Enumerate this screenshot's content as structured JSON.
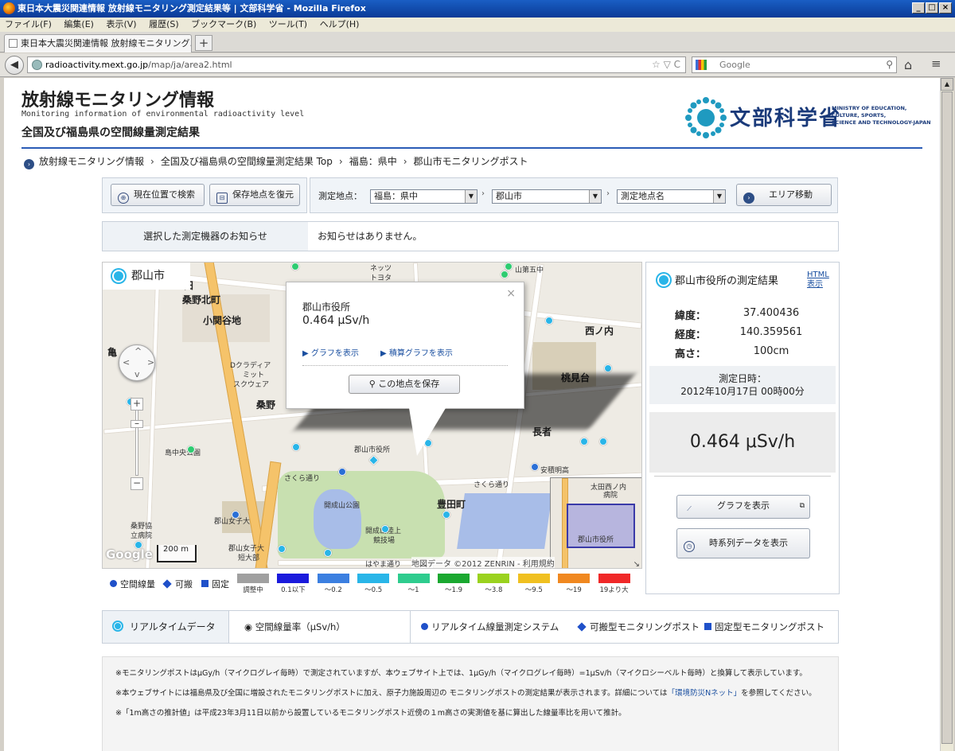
{
  "browser": {
    "title": "東日本大震災関連情報 放射線モニタリング測定結果等 | 文部科学省 - Mozilla Firefox",
    "menu": [
      "ファイル(F)",
      "編集(E)",
      "表示(V)",
      "履歴(S)",
      "ブックマーク(B)",
      "ツール(T)",
      "ヘルプ(H)"
    ],
    "tab_title": "東日本大震災関連情報 放射線モニタリング...",
    "url_host": "radioactivity.mext.go.jp",
    "url_path": "/map/ja/area2.html",
    "search_placeholder": "Google"
  },
  "header": {
    "title": "放射線モニタリング情報",
    "subtitle": "Monitoring information of environmental radioactivity level",
    "heading": "全国及び福島県の空間線量測定結果",
    "ministry_jp": "文部科学省",
    "ministry_en": [
      "MINISTRY OF EDUCATION,",
      "CULTURE, SPORTS,",
      "SCIENCE AND TECHNOLOGY-JAPAN"
    ]
  },
  "breadcrumb": [
    "放射線モニタリング情報",
    "全国及び福島県の空間線量測定結果 Top",
    "福島：県中",
    "郡山市モニタリングポスト"
  ],
  "toolbar": {
    "current_location_btn": "現在位置で検索",
    "restore_btn": "保存地点を復元",
    "point_label": "測定地点：",
    "select_area": "福島：県中",
    "select_city": "郡山市",
    "select_point": "測定地点名",
    "move_btn": "エリア移動"
  },
  "notice": {
    "label": "選択した測定機器のお知らせ",
    "value": "お知らせはありません。"
  },
  "map": {
    "title": "郡山市",
    "labels": {
      "kuwano_kita": "桑野北町",
      "koseki": "小関谷地",
      "kame": "亀",
      "kuwano": "桑野",
      "nishinouchi": "西ノ内",
      "momomidai": "桃見台",
      "nagaja": "長者",
      "toyotamachi": "豊田町",
      "kaiseizan": "開成山公園",
      "sakura1": "さくら通り",
      "sakura2": "さくら通り",
      "hayama": "はやま通り",
      "shimanaka": "島中央公園",
      "dcrassy": "Dクラディア",
      "mitto": "ミット",
      "sukueia": "スクウェア",
      "kuwano_byoin1": "桑野協",
      "kuwano_byoin2": "立病院",
      "joshi": "郡山女子大",
      "joshi2": "郡山女子大",
      "tandai": "短大部",
      "nettsu": "ネッツ",
      "toyota": "トヨタ",
      "daigo": "山第五中",
      "shiyakusho_map": "郡山市役所",
      "kaisei_rikujo": "開成山陸上",
      "kyogijo": "競技場",
      "den": "田",
      "go": "文",
      "an": "安積明高"
    },
    "popup": {
      "name": "郡山市役所",
      "value": "0.464 μSv/h",
      "graph_link": "グラフを表示",
      "cum_graph_link": "積算グラフを表示",
      "save_btn": "この地点を保存",
      "close": "×"
    },
    "inset": {
      "label1": "太田西ノ内",
      "label2": "病院",
      "label3": "郡山市役所"
    },
    "google": "Google",
    "scale_m": "200 m",
    "copyright": "地図データ ©2012 ZENRIN - 利用規約"
  },
  "legend": {
    "kinds": [
      "空間線量",
      "可搬",
      "固定"
    ],
    "bins": [
      {
        "label": "調整中",
        "color": "#a0a0a0"
      },
      {
        "label": "0.1以下",
        "color": "#1a1adc"
      },
      {
        "label": "〜0.2",
        "color": "#3b7fe0"
      },
      {
        "label": "〜0.5",
        "color": "#29b5e8"
      },
      {
        "label": "〜1",
        "color": "#2ecc8e"
      },
      {
        "label": "〜1.9",
        "color": "#1aa830"
      },
      {
        "label": "〜3.8",
        "color": "#9ad21e"
      },
      {
        "label": "〜9.5",
        "color": "#f0c020"
      },
      {
        "label": "〜19",
        "color": "#f08820"
      },
      {
        "label": "19より大",
        "color": "#f02828"
      }
    ]
  },
  "result": {
    "title": "郡山市役所の測定結果",
    "html_link": "HTML表示",
    "lat_label": "緯度：",
    "lat": "37.400436",
    "lon_label": "経度：",
    "lon": "140.359561",
    "height_label": "高さ：",
    "height": "100cm",
    "date_label": "測定日時：",
    "date": "2012年10月17日 00時00分",
    "value": "0.464 μSv/h",
    "graph_btn": "グラフを表示",
    "timeseries_btn": "時系列データを表示"
  },
  "bottom": {
    "realtime": "リアルタイムデータ",
    "rate": "空間線量率（μSv/h）",
    "sys": "リアルタイム線量測定システム",
    "portable": "可搬型モニタリングポスト",
    "fixed": "固定型モニタリングポスト"
  },
  "notes": {
    "n1": "※モニタリングポストはμGy/h（マイクログレイ毎時）で測定されていますが、本ウェブサイト上では、1μGy/h（マイクログレイ毎時）=1μSv/h（マイクロシーベルト毎時）と換算して表示しています。",
    "n2a": "※本ウェブサイトには福島県及び全国に増設されたモニタリングポストに加え、原子力施設周辺の モニタリングポストの測定結果が表示されます。詳細については",
    "n2link": "「環境防災Nネット」",
    "n2b": "を参照してください。",
    "n3": "※「1m高さの推計値」は平成23年3月11日以前から設置しているモニタリングポスト近傍の１m高さの実測値を基に算出した線量率比を用いて推計。"
  }
}
